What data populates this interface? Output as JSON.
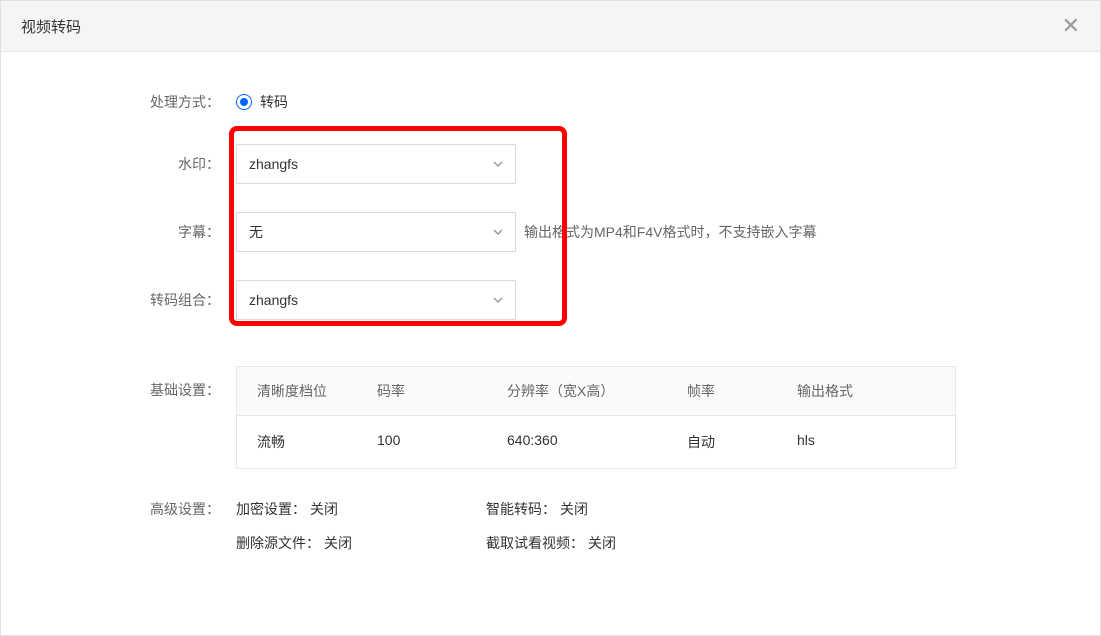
{
  "header": {
    "title": "视频转码"
  },
  "form": {
    "processing_mode_label": "处理方式：",
    "processing_mode_option": "转码",
    "watermark_label": "水印：",
    "watermark_value": "zhangfs",
    "subtitle_label": "字幕：",
    "subtitle_value": "无",
    "subtitle_hint": "输出格式为MP4和F4V格式时，不支持嵌入字幕",
    "transcode_group_label": "转码组合：",
    "transcode_group_value": "zhangfs",
    "basic_settings_label": "基础设置：",
    "advanced_settings_label": "高级设置："
  },
  "table": {
    "headers": {
      "clarity": "清晰度档位",
      "bitrate": "码率",
      "resolution": "分辨率（宽X高）",
      "framerate": "帧率",
      "output_format": "输出格式"
    },
    "rows": [
      {
        "clarity": "流畅",
        "bitrate": "100",
        "resolution": "640:360",
        "framerate": "自动",
        "output_format": "hls"
      }
    ]
  },
  "advanced": {
    "encryption_key": "加密设置：",
    "encryption_val": "关闭",
    "smart_transcode_key": "智能转码：",
    "smart_transcode_val": "关闭",
    "delete_source_key": "删除源文件：",
    "delete_source_val": "关闭",
    "preview_key": "截取试看视频：",
    "preview_val": "关闭"
  }
}
